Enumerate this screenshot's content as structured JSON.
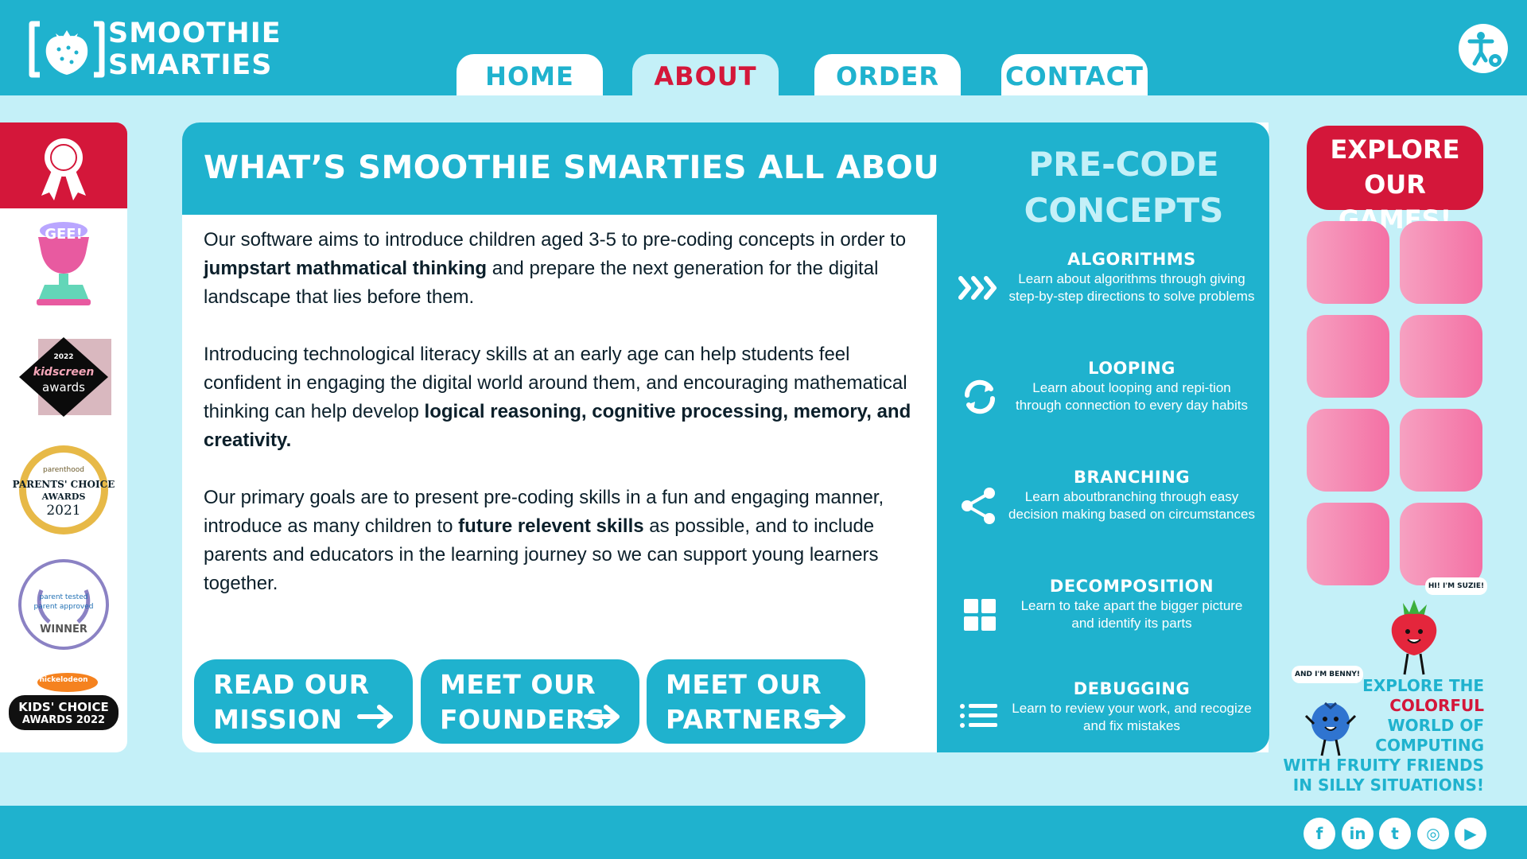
{
  "brand": {
    "name_line1": "SMOOTHIE",
    "name_line2": "SMARTIES"
  },
  "nav": {
    "tabs": [
      {
        "label": "HOME",
        "active": false
      },
      {
        "label": "ABOUT",
        "active": true
      },
      {
        "label": "ORDER",
        "active": false
      },
      {
        "label": "CONTACT",
        "active": false
      }
    ]
  },
  "awards": [
    {
      "icon": "ribbon-icon"
    },
    {
      "name": "GEE!",
      "icon": "trophy-icon"
    },
    {
      "year": "2022",
      "line1": "kidscreen",
      "line2": "awards"
    },
    {
      "brand": "parenthood",
      "line1": "PARENTS' CHOICE",
      "line2": "AWARDS",
      "year": "2021"
    },
    {
      "line1": "parent tested",
      "line2": "parent approved",
      "label": "WINNER"
    },
    {
      "brand": "nickelodeon",
      "line1": "KIDS' CHOICE",
      "line2": "AWARDS 2022"
    }
  ],
  "main": {
    "title": "WHAT’S SMOOTHIE SMARTIES ALL ABOUT?",
    "paragraphs": [
      {
        "before": "Our software aims to introduce children aged 3-5 to pre-coding concepts in order to ",
        "bold": "jumpstart mathmatical thinking",
        "after": " and prepare the next generation for the digital landscape that lies before them."
      },
      {
        "before": "Introducing technological literacy skills at an early age can help students feel confident in engaging the digital world around them, and encouraging mathematical thinking can help develop ",
        "bold": "logical reasoning, cognitive processing, memory, and creativity.",
        "after": ""
      },
      {
        "before": "Our primary goals are to present pre-coding skills in a fun and engaging manner, introduce as many children to ",
        "bold": "future relevent skills",
        "after": " as possible, and to include parents and educators in the learning journey so we can support young learners together."
      }
    ],
    "ctas": [
      {
        "line1": "READ OUR",
        "line2": "MISSION"
      },
      {
        "line1": "MEET OUR",
        "line2": "FOUNDERS"
      },
      {
        "line1": "MEET OUR",
        "line2": "PARTNERS"
      }
    ]
  },
  "concepts": {
    "title_line1": "PRE-CODE",
    "title_line2": "CONCEPTS",
    "items": [
      {
        "name": "ALGORITHMS",
        "desc": "Learn about algorithms through giving step-by-step directions to solve problems",
        "icon": "chevrons-right-icon"
      },
      {
        "name": "LOOPING",
        "desc": "Learn about looping and repi-tion through connection to every day habits",
        "icon": "refresh-icon"
      },
      {
        "name": "BRANCHING",
        "desc": "Learn aboutbranching through easy decision making based on circumstances",
        "icon": "share-icon"
      },
      {
        "name": "DECOMPOSITION",
        "desc": "Learn to take apart the bigger picture and identify its parts",
        "icon": "grid-icon"
      },
      {
        "name": "DEBUGGING",
        "desc": "Learn to review your work, and recogize and fix mistakes",
        "icon": "list-icon"
      }
    ]
  },
  "games": {
    "explore_line1": "EXPLORE",
    "explore_line2": "OUR GAMES!",
    "tile_count": 8
  },
  "mascots": {
    "suzie_bubble": "HI! I'M SUZIE!",
    "benny_bubble": "AND I'M BENNY!",
    "tagline": {
      "line1": "EXPLORE THE",
      "line2": "COLORFUL",
      "line3": "WORLD OF",
      "line4": "COMPUTING",
      "line5": "WITH FRUITY FRIENDS",
      "line6": "IN SILLY SITUATIONS!"
    }
  },
  "footer": {
    "social": [
      {
        "label": "f",
        "icon": "facebook-icon"
      },
      {
        "label": "in",
        "icon": "linkedin-icon"
      },
      {
        "label": "t",
        "icon": "twitter-icon"
      },
      {
        "label": "◎",
        "icon": "instagram-icon"
      },
      {
        "label": "▶",
        "icon": "youtube-icon"
      }
    ]
  },
  "colors": {
    "teal": "#1fb2ce",
    "light_cyan": "#c4f0f8",
    "red": "#d4173a",
    "pink": "#f470a4"
  }
}
